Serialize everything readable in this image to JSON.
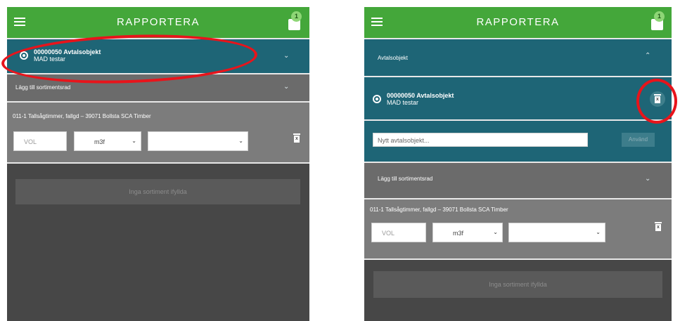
{
  "app": {
    "title": "RAPPORTERA",
    "cart_count": "1",
    "accent": "#44a73a",
    "teal": "#1e6576"
  },
  "left": {
    "selected_object": {
      "number_name": "00000050 Avtalsobjekt",
      "subtitle": "MAD testar"
    },
    "add_row_label": "Lägg till sortimentsrad",
    "product": {
      "label": "011-1 Tallsågtimmer, fallgd – 39071 Bollsta SCA Timber",
      "volume_placeholder": "VOL",
      "unit_value": "m3f",
      "third_value": ""
    },
    "empty_button": "Inga sortiment ifyllda"
  },
  "right": {
    "section_label": "Avtalsobjekt",
    "selected_object": {
      "number_name": "00000050 Avtalsobjekt",
      "subtitle": "MAD testar"
    },
    "new_object_placeholder": "Nytt avtalsobjekt...",
    "use_button": "Använd",
    "add_row_label": "Lägg till sortimentsrad",
    "product": {
      "label": "011-1 Tallsågtimmer, fallgd – 39071 Bollsta SCA Timber",
      "volume_placeholder": "VOL",
      "unit_value": "m3f",
      "third_value": ""
    },
    "empty_button": "Inga sortiment ifyllda"
  },
  "icons": [
    "menu-icon",
    "cart-icon",
    "chevron-down-icon",
    "chevron-up-icon",
    "radio-selected-icon",
    "trash-icon"
  ],
  "annotation_color": "#e8141b"
}
